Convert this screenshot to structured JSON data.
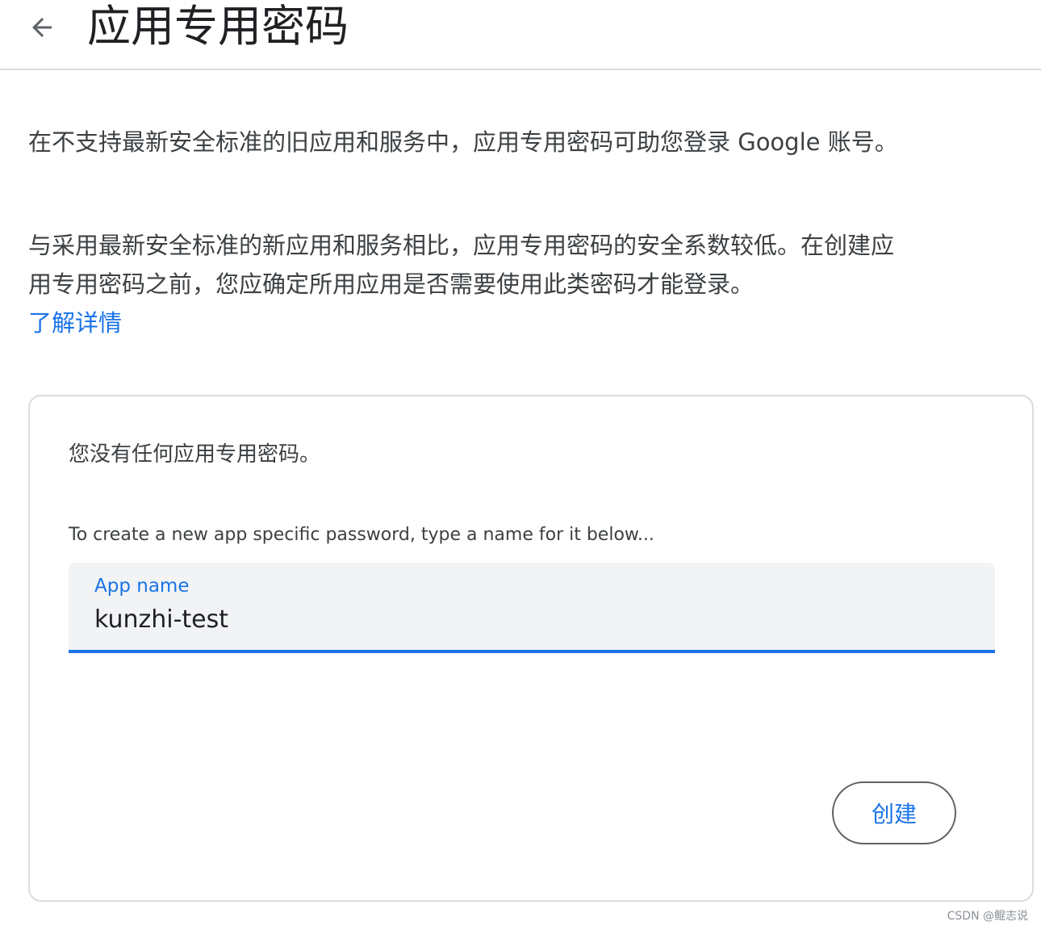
{
  "header": {
    "back_icon": "arrow-left-icon",
    "title": "应用专用密码"
  },
  "intro": {
    "paragraph1": "在不支持最新安全标准的旧应用和服务中，应用专用密码可助您登录 Google 账号。",
    "paragraph2": "与采用最新安全标准的新应用和服务相比，应用专用密码的安全系数较低。在创建应用专用密码之前，您应确定所用应用是否需要使用此类密码才能登录。",
    "learn_more": "了解详情"
  },
  "card": {
    "empty_message": "您没有任何应用专用密码。",
    "create_hint": "To create a new app specific password, type a name for it below...",
    "field_label": "App name",
    "field_value": "kunzhi-test",
    "create_button": "创建"
  },
  "watermark": "CSDN @鲲志说",
  "colors": {
    "accent": "#1a73e8",
    "text": "#202124",
    "field_bg": "#f1f3f4",
    "border": "#dadce0"
  }
}
